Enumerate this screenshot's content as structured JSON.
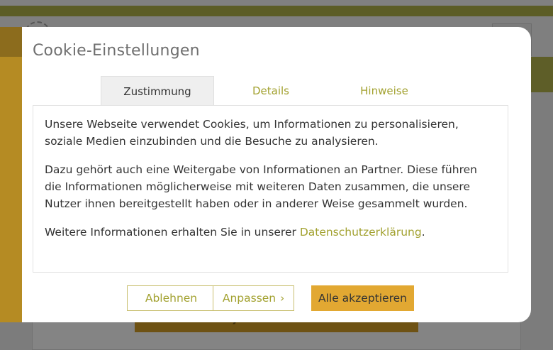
{
  "modal": {
    "title": "Cookie-Einstellungen",
    "tabs": [
      {
        "label": "Zustimmung",
        "active": true
      },
      {
        "label": "Details",
        "active": false
      },
      {
        "label": "Hinweise",
        "active": false
      }
    ],
    "paragraph1": "Unsere Webseite verwendet Cookies, um Informationen zu personalisieren, soziale Medien einzubinden und die Besuche zu analysieren.",
    "paragraph2": "Dazu gehört auch eine Weitergabe von Informationen an Partner. Diese führen die Informationen möglicherweise mit weiteren Daten zusammen, die unsere Nutzer ihnen bereitgestellt haben oder in anderer Weise gesammelt wurden.",
    "paragraph3_prefix": "Weitere Informationen erhalten Sie in unserer ",
    "paragraph3_link": "Datenschutzerklärung",
    "paragraph3_suffix": ".",
    "buttons": {
      "decline": "Ablehnen",
      "adjust": "Anpassen",
      "accept": "Alle akzeptieren"
    }
  },
  "colors": {
    "accent_olive": "#a2a12f",
    "accept_button": "#e2a832",
    "overlay": "#7c7c7c"
  },
  "icons": {
    "adjust_chevron": "chevron-right-icon",
    "loading": "spinner-icon"
  }
}
